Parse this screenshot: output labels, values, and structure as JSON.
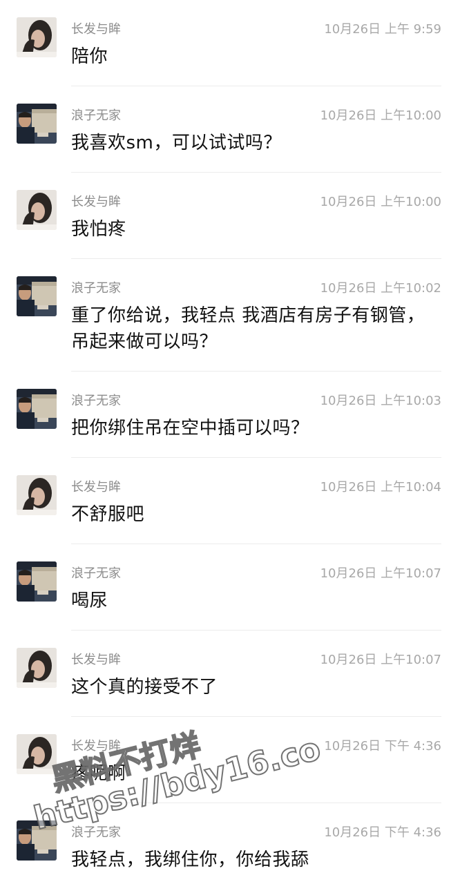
{
  "messages": [
    {
      "sender": "长发与眸",
      "time": "10月26日 上午 9:59",
      "text": "陪你",
      "avatar": "woman-avatar"
    },
    {
      "sender": "浪子无家",
      "time": "10月26日 上午10:00",
      "text": "我喜欢sm，可以试试吗？",
      "avatar": "man-car-avatar"
    },
    {
      "sender": "长发与眸",
      "time": "10月26日 上午10:00",
      "text": "我怕疼",
      "avatar": "woman-avatar"
    },
    {
      "sender": "浪子无家",
      "time": "10月26日 上午10:02",
      "text": "重了你给说，我轻点 我酒店有房子有钢管，吊起来做可以吗？",
      "avatar": "man-car-avatar"
    },
    {
      "sender": "浪子无家",
      "time": "10月26日 上午10:03",
      "text": "把你绑住吊在空中插可以吗？",
      "avatar": "man-car-avatar"
    },
    {
      "sender": "长发与眸",
      "time": "10月26日 上午10:04",
      "text": "不舒服吧",
      "avatar": "woman-avatar"
    },
    {
      "sender": "浪子无家",
      "time": "10月26日 上午10:07",
      "text": "喝尿",
      "avatar": "man-car-avatar"
    },
    {
      "sender": "长发与眸",
      "time": "10月26日 上午10:07",
      "text": "这个真的接受不了",
      "avatar": "woman-avatar"
    },
    {
      "sender": "长发与眸",
      "time": "10月26日 下午 4:36",
      "text": "疼呢啊",
      "avatar": "woman-avatar"
    },
    {
      "sender": "浪子无家",
      "time": "10月26日 下午 4:36",
      "text": "我轻点，我绑住你，你给我舔",
      "avatar": "man-car-avatar"
    }
  ],
  "watermark": {
    "line1": "黑料不打烊",
    "line2": "https://bdy16.co"
  },
  "colors": {
    "name": "#8c8c8c",
    "time": "#a8a8a8",
    "text": "#111111",
    "divider": "#ececec"
  }
}
